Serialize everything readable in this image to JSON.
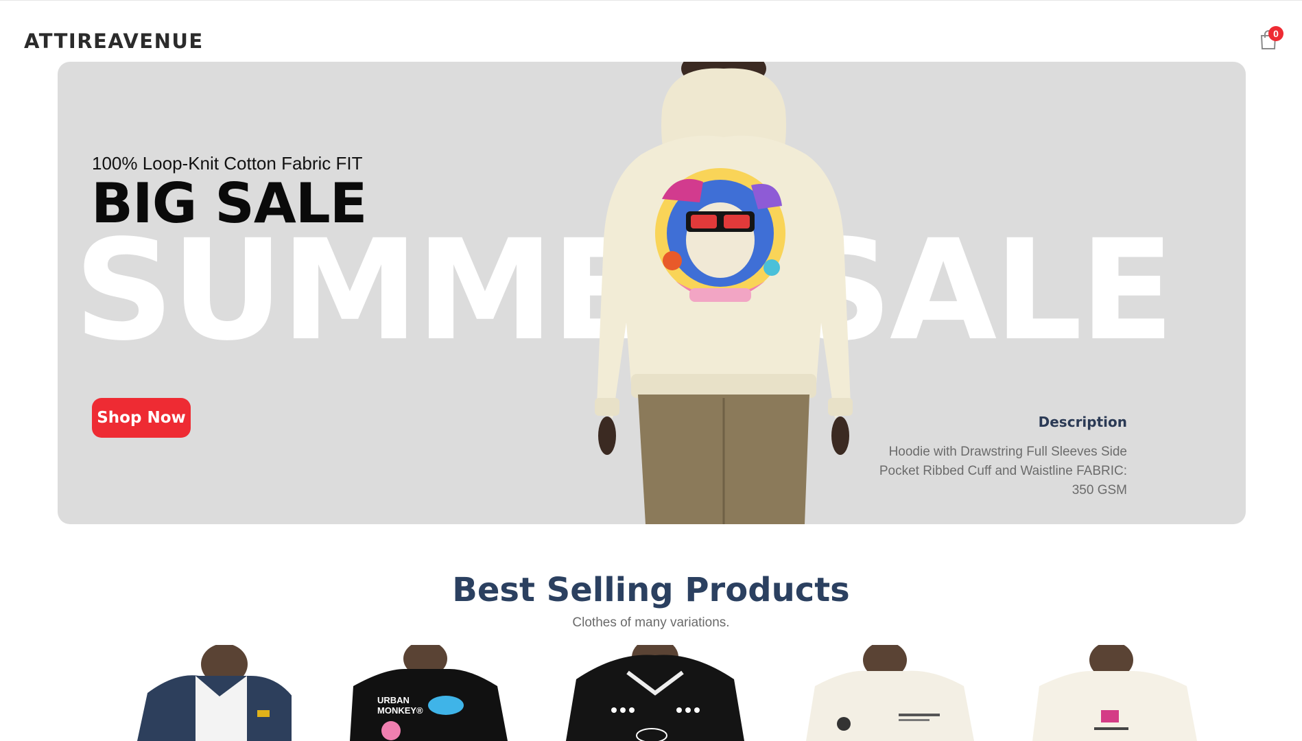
{
  "header": {
    "logo": "ATTIREAVENUE",
    "cart_count": "0",
    "cart_icon": "shopping-bag-icon"
  },
  "hero": {
    "subtitle": "100% Loop-Knit Cotton Fabric FIT",
    "title": "BIG SALE",
    "background_word": "SUMMER SALE",
    "cta_label": "Shop Now",
    "description_title": "Description",
    "description_text": "Hoodie with Drawstring Full Sleeves Side Pocket Ribbed Cuff and Waistline FABRIC: 350 GSM",
    "colors": {
      "background": "#dcdcdc",
      "cta": "#ee2b33",
      "hoodie": "#f2ecd6",
      "pants": "#8b7a5a"
    }
  },
  "best_selling": {
    "title": "Best Selling Products",
    "subtitle": "Clothes of many variations.",
    "products": [
      {
        "name": "denim-jacket",
        "color": "#2d3f5c"
      },
      {
        "name": "black-tee-urban-monkey",
        "color": "#111111",
        "print": "URBAN MONKEY®"
      },
      {
        "name": "black-hoodie",
        "color": "#141414"
      },
      {
        "name": "cream-sweatshirt",
        "color": "#f3efe4"
      },
      {
        "name": "cream-tee",
        "color": "#f5f1e6"
      }
    ]
  }
}
